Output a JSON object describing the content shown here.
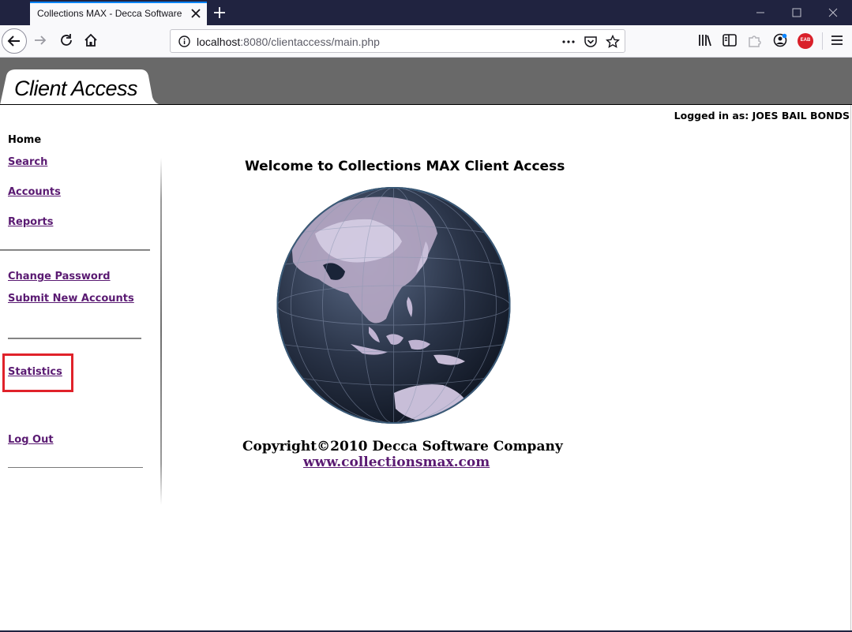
{
  "browser": {
    "tab_title": "Collections MAX - Decca Software Company",
    "url_host": "localhost",
    "url_path": ":8080/clientaccess/main.php",
    "addon_badge": "EAB"
  },
  "header": {
    "brand": "Client Access",
    "logged_in": "Logged in as: JOES BAIL BONDS"
  },
  "sidebar": {
    "home": "Home",
    "search": "Search",
    "accounts": "Accounts",
    "reports": "Reports",
    "change_password": "Change Password",
    "submit_new_accounts": "Submit New Accounts",
    "statistics": "Statistics",
    "logout": "Log Out"
  },
  "main": {
    "welcome": "Welcome to Collections MAX Client Access",
    "copyright": "Copyright©2010 Decca Software Company",
    "site_url": "www.collectionsmax.com"
  },
  "colors": {
    "banner": "#696969",
    "link": "#5a1a72",
    "highlight": "#e0222a",
    "tabbar": "#202340"
  }
}
